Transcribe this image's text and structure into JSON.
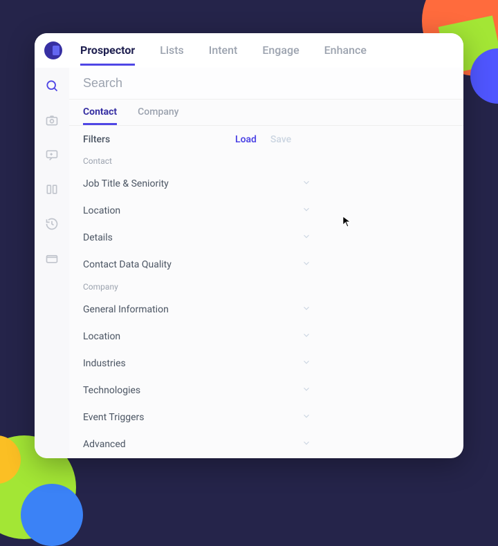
{
  "nav": {
    "tabs": [
      "Prospector",
      "Lists",
      "Intent",
      "Engage",
      "Enhance"
    ],
    "activeIndex": 0
  },
  "iconbar": {
    "items": [
      {
        "name": "search-icon"
      },
      {
        "name": "camera-icon"
      },
      {
        "name": "chat-icon"
      },
      {
        "name": "columns-icon"
      },
      {
        "name": "history-icon"
      },
      {
        "name": "wallet-icon"
      }
    ]
  },
  "search": {
    "placeholder": "Search",
    "value": ""
  },
  "subtabs": {
    "items": [
      "Contact",
      "Company"
    ],
    "activeIndex": 0
  },
  "filters": {
    "title": "Filters",
    "load_label": "Load",
    "save_label": "Save",
    "groups": [
      {
        "label": "Contact",
        "items": [
          "Job Title & Seniority",
          "Location",
          "Details",
          "Contact Data Quality"
        ]
      },
      {
        "label": "Company",
        "items": [
          "General Information",
          "Location",
          "Industries",
          "Technologies",
          "Event Triggers",
          "Advanced"
        ]
      }
    ]
  },
  "colors": {
    "accent": "#4f46e5",
    "text": "#4b5563",
    "muted": "#9ca3af",
    "bgDark": "#25244a"
  }
}
